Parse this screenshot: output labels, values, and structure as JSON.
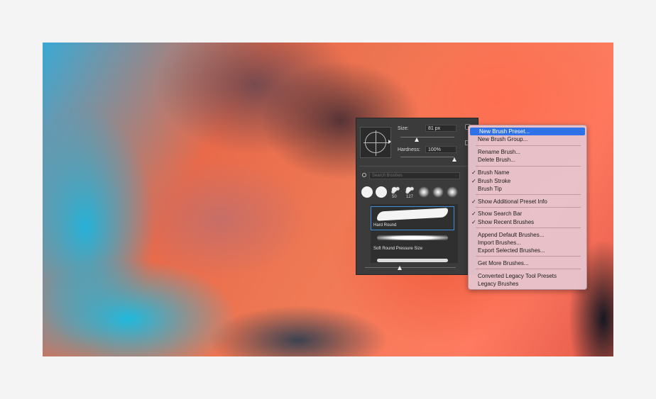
{
  "panel": {
    "size_label": "Size:",
    "size_value": "81 px",
    "size_fraction": 0.3,
    "hardness_label": "Hardness:",
    "hardness_value": "100%",
    "hardness_fraction": 1.0,
    "search_placeholder": "Search Brushes",
    "tips": [
      {
        "kind": "hard",
        "num": ""
      },
      {
        "kind": "hard",
        "num": ""
      },
      {
        "kind": "scatter",
        "num": "50"
      },
      {
        "kind": "scatter2",
        "num": "127"
      },
      {
        "kind": "soft",
        "num": ""
      },
      {
        "kind": "soft",
        "num": ""
      },
      {
        "kind": "soft",
        "num": ""
      }
    ],
    "brushes": [
      {
        "label": "Hard Round",
        "selected": true
      },
      {
        "label": "Soft Round Pressure Size",
        "selected": false
      }
    ]
  },
  "menu": {
    "items": [
      {
        "label": "New Brush Preset...",
        "checked": false,
        "highlight": true
      },
      {
        "label": "New Brush Group...",
        "checked": false
      },
      {
        "sep": true
      },
      {
        "label": "Rename Brush...",
        "checked": false
      },
      {
        "label": "Delete Brush...",
        "checked": false
      },
      {
        "sep": true
      },
      {
        "label": "Brush Name",
        "checked": true
      },
      {
        "label": "Brush Stroke",
        "checked": true
      },
      {
        "label": "Brush Tip",
        "checked": false
      },
      {
        "sep": true
      },
      {
        "label": "Show Additional Preset Info",
        "checked": true
      },
      {
        "sep": true
      },
      {
        "label": "Show Search Bar",
        "checked": true
      },
      {
        "label": "Show Recent Brushes",
        "checked": true
      },
      {
        "sep": true
      },
      {
        "label": "Append Default Brushes...",
        "checked": false
      },
      {
        "label": "Import Brushes...",
        "checked": false
      },
      {
        "label": "Export Selected Brushes...",
        "checked": false
      },
      {
        "sep": true
      },
      {
        "label": "Get More Brushes...",
        "checked": false
      },
      {
        "sep": true
      },
      {
        "label": "Converted Legacy Tool Presets",
        "checked": false
      },
      {
        "label": "Legacy Brushes",
        "checked": false
      }
    ]
  },
  "check_glyph": "✓"
}
